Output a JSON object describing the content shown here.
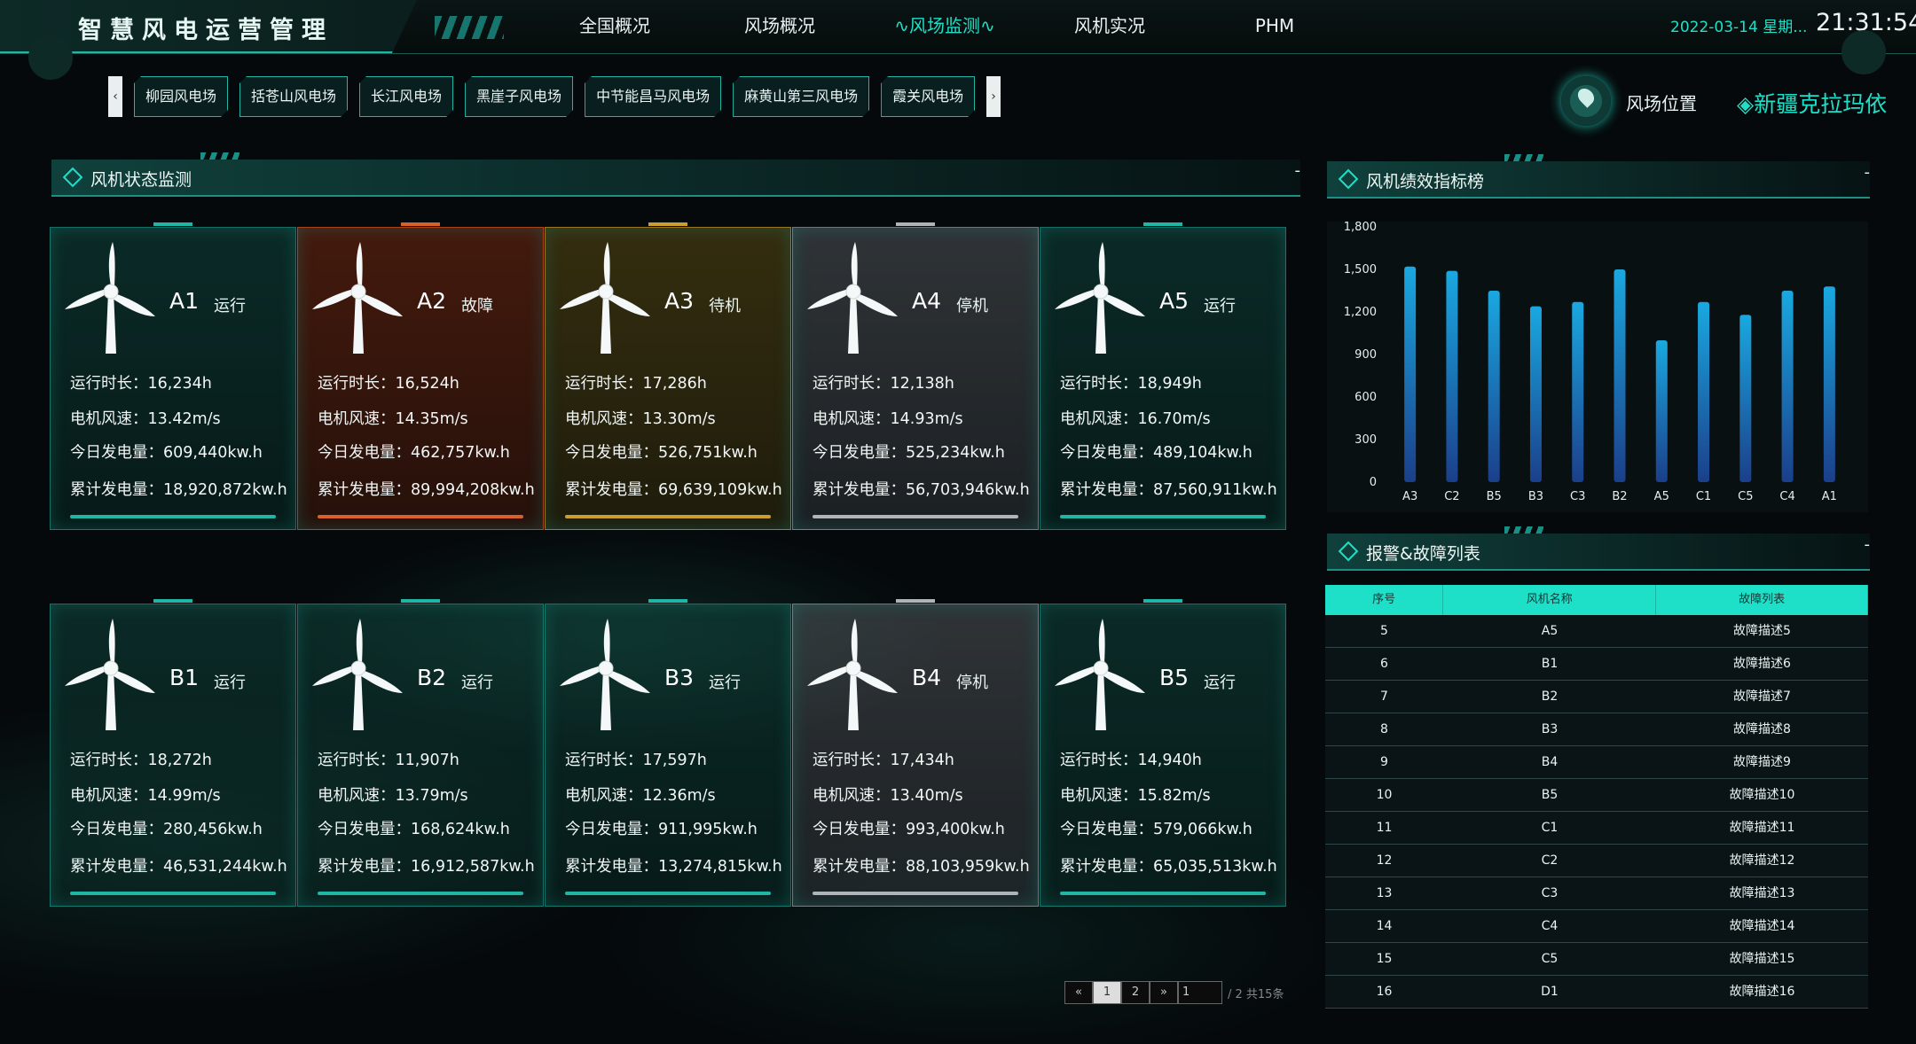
{
  "header": {
    "app_title": "智慧风电运营管理",
    "nav": [
      "全国概况",
      "风场概况",
      "风场监测",
      "风机实况",
      "PHM"
    ],
    "active_nav": "风场监测",
    "date": "2022-03-14 星期...",
    "time": "21:31:54"
  },
  "stations": [
    "柳园风电场",
    "括苍山风电场",
    "长江风电场",
    "黑崖子风电场",
    "中节能昌马风电场",
    "麻黄山第三风电场",
    "霞关风电场"
  ],
  "tab_prev": "‹",
  "tab_next": "›",
  "location": {
    "label": "风场位置",
    "value": "新疆克拉玛依"
  },
  "status_panel": {
    "title": "风机状态监测",
    "dash": "-"
  },
  "labels": {
    "runtime": "运行时长：",
    "windspeed": "电机风速：",
    "today_power": "今日发电量：",
    "total_power": "累计发电量："
  },
  "turbines": [
    {
      "id": "A1",
      "status": "运行",
      "runtime": "16,234h",
      "wind": "13.42m/s",
      "today": "609,440kw.h",
      "total": "18,920,872kw.h",
      "kind": "run"
    },
    {
      "id": "A2",
      "status": "故障",
      "runtime": "16,524h",
      "wind": "14.35m/s",
      "today": "462,757kw.h",
      "total": "89,994,208kw.h",
      "kind": "fault"
    },
    {
      "id": "A3",
      "status": "待机",
      "runtime": "17,286h",
      "wind": "13.30m/s",
      "today": "526,751kw.h",
      "total": "69,639,109kw.h",
      "kind": "standby"
    },
    {
      "id": "A4",
      "status": "停机",
      "runtime": "12,138h",
      "wind": "14.93m/s",
      "today": "525,234kw.h",
      "total": "56,703,946kw.h",
      "kind": "stopped"
    },
    {
      "id": "A5",
      "status": "运行",
      "runtime": "18,949h",
      "wind": "16.70m/s",
      "today": "489,104kw.h",
      "total": "87,560,911kw.h",
      "kind": "run"
    },
    {
      "id": "B1",
      "status": "运行",
      "runtime": "18,272h",
      "wind": "14.99m/s",
      "today": "280,456kw.h",
      "total": "46,531,244kw.h",
      "kind": "run"
    },
    {
      "id": "B2",
      "status": "运行",
      "runtime": "11,907h",
      "wind": "13.79m/s",
      "today": "168,624kw.h",
      "total": "16,912,587kw.h",
      "kind": "run"
    },
    {
      "id": "B3",
      "status": "运行",
      "runtime": "17,597h",
      "wind": "12.36m/s",
      "today": "911,995kw.h",
      "total": "13,274,815kw.h",
      "kind": "run"
    },
    {
      "id": "B4",
      "status": "停机",
      "runtime": "17,434h",
      "wind": "13.40m/s",
      "today": "993,400kw.h",
      "total": "88,103,959kw.h",
      "kind": "stopped"
    },
    {
      "id": "B5",
      "status": "运行",
      "runtime": "14,940h",
      "wind": "15.82m/s",
      "today": "579,066kw.h",
      "total": "65,035,513kw.h",
      "kind": "run"
    }
  ],
  "perf_panel": {
    "title": "风机绩效指标榜",
    "dash": "-"
  },
  "chart_data": {
    "type": "bar",
    "categories": [
      "A3",
      "C2",
      "B5",
      "B3",
      "C3",
      "B2",
      "A5",
      "C1",
      "C5",
      "C4",
      "A1"
    ],
    "values": [
      1520,
      1490,
      1350,
      1240,
      1270,
      1500,
      1000,
      1270,
      1180,
      1350,
      1380
    ],
    "ylim": [
      0,
      1800
    ],
    "yticks": [
      "0",
      "300",
      "600",
      "900",
      "1,200",
      "1,500",
      "1,800"
    ],
    "ytick_values": [
      0,
      300,
      600,
      900,
      1200,
      1500,
      1800
    ],
    "bar_color_top": "#1aa8e0",
    "bar_color_bottom": "#1b3f8a"
  },
  "alarm_panel": {
    "title": "报警&故障列表",
    "dash": "-"
  },
  "alarm_table": {
    "headers": [
      "序号",
      "风机名称",
      "故障列表"
    ],
    "rows": [
      [
        "5",
        "A5",
        "故障描述5"
      ],
      [
        "6",
        "B1",
        "故障描述6"
      ],
      [
        "7",
        "B2",
        "故障描述7"
      ],
      [
        "8",
        "B3",
        "故障描述8"
      ],
      [
        "9",
        "B4",
        "故障描述9"
      ],
      [
        "10",
        "B5",
        "故障描述10"
      ],
      [
        "11",
        "C1",
        "故障描述11"
      ],
      [
        "12",
        "C2",
        "故障描述12"
      ],
      [
        "13",
        "C3",
        "故障描述13"
      ],
      [
        "14",
        "C4",
        "故障描述14"
      ],
      [
        "15",
        "C5",
        "故障描述15"
      ],
      [
        "16",
        "D1",
        "故障描述16"
      ]
    ]
  },
  "pager": {
    "prev": "«",
    "pages": [
      "1",
      "2"
    ],
    "next": "»",
    "input": "1",
    "total": "/ 2 共15条"
  }
}
